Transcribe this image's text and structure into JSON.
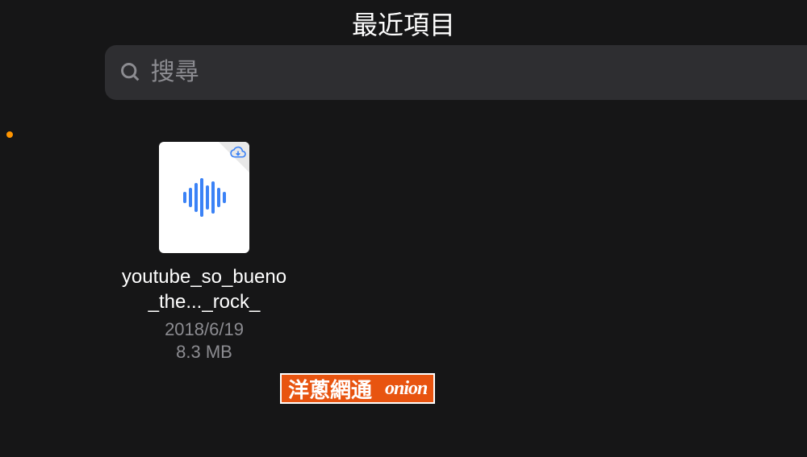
{
  "header": {
    "title": "最近項目"
  },
  "search": {
    "placeholder": "搜尋"
  },
  "files": [
    {
      "name": "youtube_so_bueno_the..._rock_",
      "date": "2018/6/19",
      "size": "8.3 MB"
    }
  ],
  "watermark": {
    "left": "洋蔥網通",
    "right": "onion"
  }
}
